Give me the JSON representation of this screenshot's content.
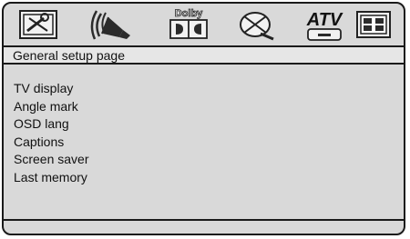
{
  "icons": [
    {
      "name": "general-setup-icon"
    },
    {
      "name": "audio-speaker-icon"
    },
    {
      "name": "dolby-icon",
      "label": "Dolby"
    },
    {
      "name": "disc-preference-icon"
    },
    {
      "name": "atv-icon",
      "label": "ATV"
    },
    {
      "name": "video-setup-icon"
    }
  ],
  "page": {
    "title": "General setup page"
  },
  "menu": {
    "items": [
      {
        "label": "TV display"
      },
      {
        "label": "Angle mark"
      },
      {
        "label": "OSD lang"
      },
      {
        "label": "Captions"
      },
      {
        "label": "Screen saver"
      },
      {
        "label": "Last memory"
      }
    ]
  },
  "colors": {
    "background": "#d9d9d9",
    "title_bar": "#e6e6e6",
    "border": "#1a1a1a",
    "icon_fill": "#2b2b2b"
  }
}
